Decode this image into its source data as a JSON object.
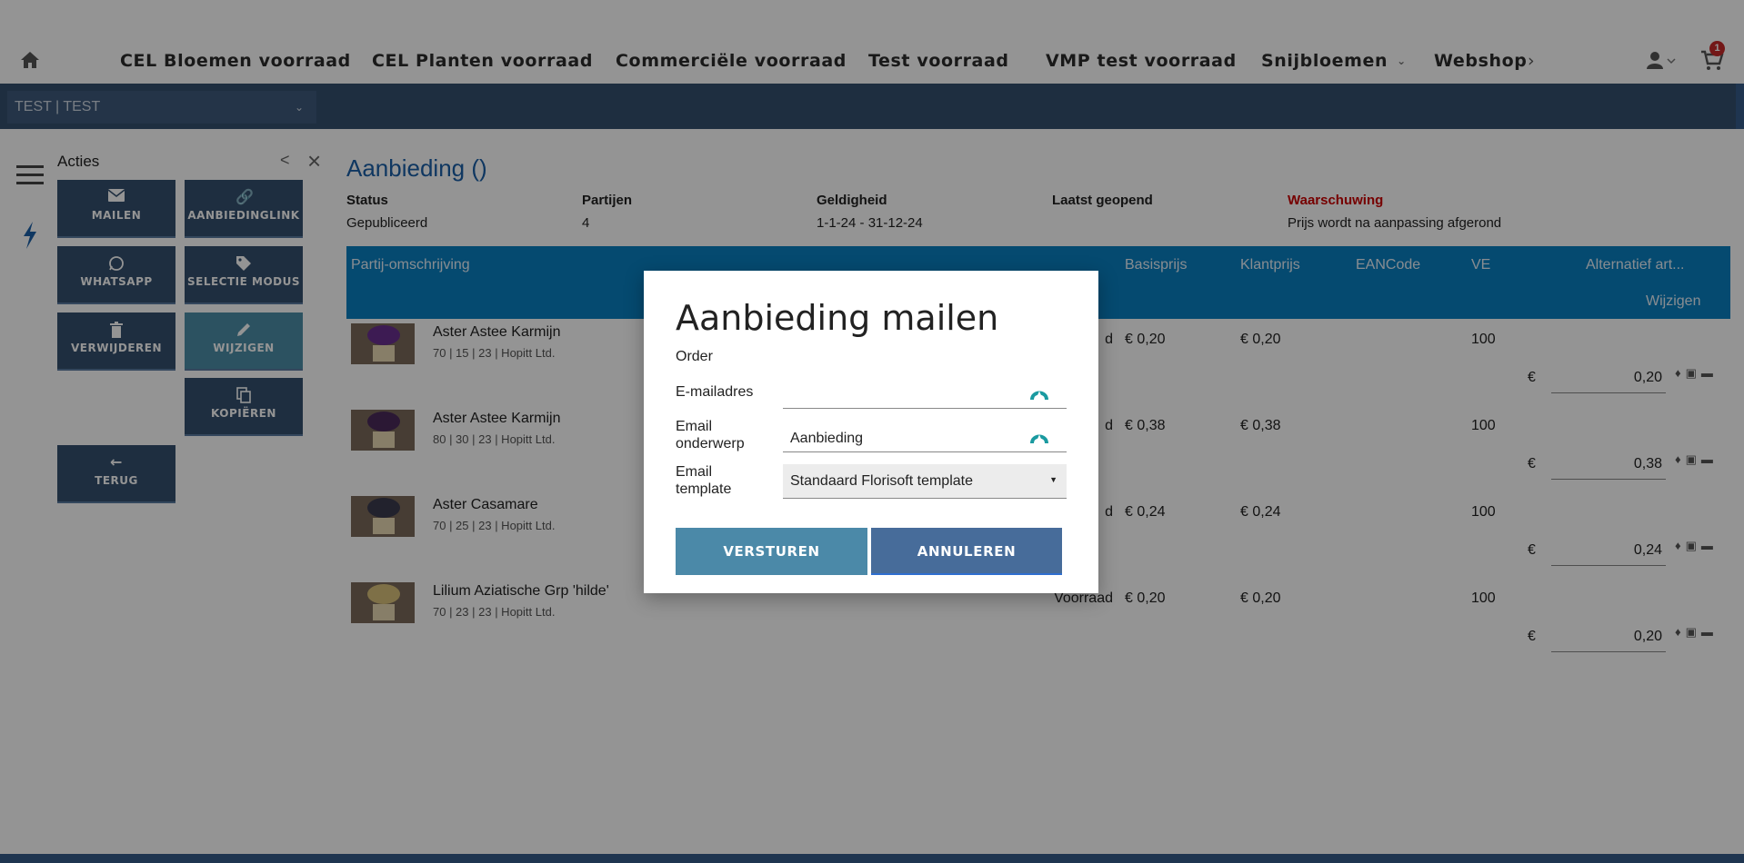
{
  "nav": {
    "items": [
      "CEL Bloemen voorraad",
      "CEL Planten voorraad",
      "Commerciële voorraad",
      "Test voorraad",
      "VMP test voorraad",
      "Snijbloemen",
      "Webshop"
    ],
    "cart_count": "1"
  },
  "context_select": "TEST | TEST",
  "actions": {
    "title": "Acties",
    "buttons": [
      "MAILEN",
      "AANBIEDINGLINK",
      "WHATSAPP",
      "SELECTIE MODUS",
      "VERWIJDEREN",
      "WIJZIGEN",
      "KOPIËREN",
      "TERUG"
    ]
  },
  "offer": {
    "title": "Aanbieding ()",
    "meta": [
      {
        "label": "Status",
        "value": "Gepubliceerd"
      },
      {
        "label": "Partijen",
        "value": "4"
      },
      {
        "label": "Geldigheid",
        "value": "1-1-24 - 31-12-24"
      },
      {
        "label": "Laatst geopend",
        "value": ""
      },
      {
        "label": "Waarschuwing",
        "value": "Prijs wordt na aanpassing afgerond"
      }
    ]
  },
  "table": {
    "headers": [
      "Partij-omschrijving",
      "Basisprijs",
      "Klantprijs",
      "EANCode",
      "VE",
      "Alternatief art...",
      "Wijzigen"
    ],
    "rows": [
      {
        "name": "Aster Astee Karmijn",
        "sub": "70 | 15 | 23 | Hopitt Ltd.",
        "status": "d",
        "basis": "€ 0,20",
        "klant": "€ 0,20",
        "ve": "100",
        "price": "0,20",
        "currency": "€"
      },
      {
        "name": "Aster Astee Karmijn",
        "sub": "80 | 30 | 23 | Hopitt Ltd.",
        "status": "d",
        "basis": "€ 0,38",
        "klant": "€ 0,38",
        "ve": "100",
        "price": "0,38",
        "currency": "€"
      },
      {
        "name": "Aster Casamare",
        "sub": "70 | 25 | 23 | Hopitt Ltd.",
        "status": "d",
        "basis": "€ 0,24",
        "klant": "€ 0,24",
        "ve": "100",
        "price": "0,24",
        "currency": "€"
      },
      {
        "name": "Lilium Aziatische Grp 'hilde'",
        "sub": "70 | 23 | 23 | Hopitt Ltd.",
        "status": "Voorraad",
        "basis": "€ 0,20",
        "klant": "€ 0,20",
        "ve": "100",
        "price": "0,20",
        "currency": "€"
      }
    ]
  },
  "modal": {
    "title": "Aanbieding mailen",
    "order_label": "Order",
    "email_label": "E-mailadres",
    "email_value": "",
    "subject_label": "Email onderwerp",
    "subject_value": "Aanbieding",
    "template_label": "Email template",
    "template_value": "Standaard Florisoft template",
    "send_label": "VERSTUREN",
    "cancel_label": "ANNULEREN"
  },
  "colors": {
    "brand_blue": "#34506f",
    "header_blue": "#0a80c2",
    "warning": "#c00000",
    "badge": "#c62828"
  }
}
